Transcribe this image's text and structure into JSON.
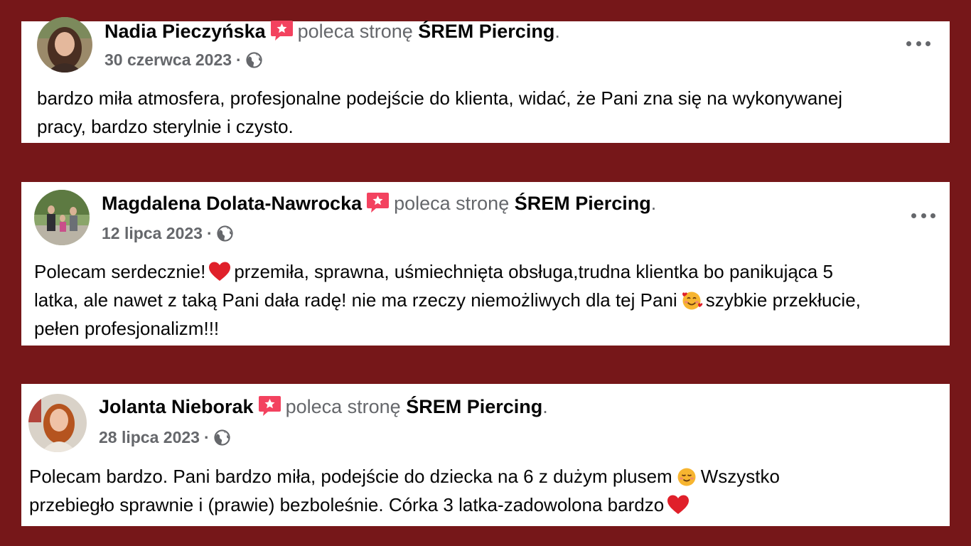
{
  "colors": {
    "background": "#761719",
    "card": "#ffffff",
    "primary_text": "#050505",
    "secondary_text": "#65676b",
    "recommend_icon": "#f3425f"
  },
  "reviews": [
    {
      "author": "Nadia Pieczyńska",
      "recommend_text": "poleca stronę",
      "page_name": "ŚREM Piercing",
      "period": ".",
      "date": "30 czerwca 2023",
      "separator": "·",
      "privacy_icon": "globe-icon",
      "text_lines": [
        "bardzo miła atmosfera, profesjonalne podejście do klienta, widać, że Pani zna się na wykonywanej",
        "pracy, bardzo sterylnie i czysto."
      ]
    },
    {
      "author": "Magdalena Dolata-Nawrocka",
      "recommend_text": "poleca stronę",
      "page_name": "ŚREM Piercing",
      "period": ".",
      "date": "12 lipca 2023",
      "separator": "·",
      "privacy_icon": "globe-icon",
      "text_parts": {
        "p1": "Polecam serdecznie!",
        "p2": "przemiła, sprawna, uśmiechnięta obsługa,trudna klientka bo panikująca 5",
        "p3": "latka, ale nawet z taką Pani dała radę! nie ma rzeczy niemożliwych dla tej Pani",
        "p4": "szybkie przekłucie,",
        "p5": "pełen profesjonalizm!!!"
      },
      "emojis": [
        "red-heart-icon",
        "smiling-face-with-hearts-icon"
      ]
    },
    {
      "author": "Jolanta Nieborak",
      "recommend_text": "poleca stronę",
      "page_name": "ŚREM Piercing",
      "period": ".",
      "date": "28 lipca 2023",
      "separator": "·",
      "privacy_icon": "globe-icon",
      "text_parts": {
        "p1": "Polecam bardzo. Pani bardzo miła, podejście do dziecka na 6 z dużym plusem",
        "p2": "Wszystko",
        "p3": "przebiegło sprawnie i (prawie) bezboleśnie. Córka 3 latka-zadowolona bardzo"
      },
      "emojis": [
        "relieved-face-icon",
        "red-heart-icon"
      ]
    }
  ]
}
